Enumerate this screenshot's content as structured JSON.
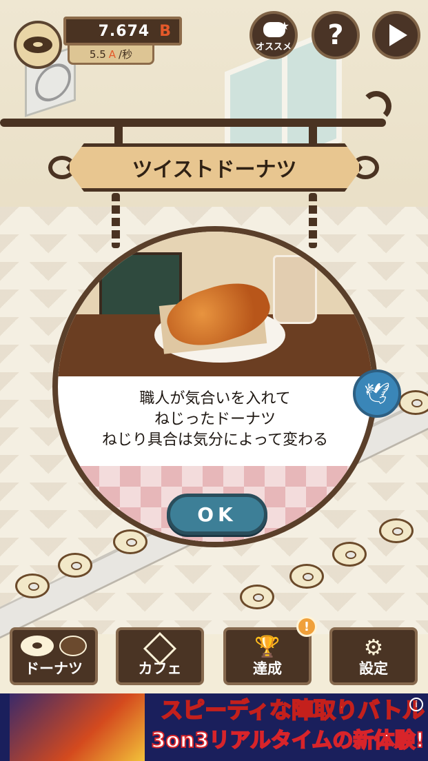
{
  "hud": {
    "money_value": "7.674",
    "money_unit": "B",
    "rate_value": "5.5",
    "rate_unit": "A",
    "rate_suffix": "/秒"
  },
  "top_buttons": {
    "recommend_label": "オススメ",
    "help_label": "?"
  },
  "sign": {
    "title": "ツイストドーナツ"
  },
  "popup": {
    "description": [
      "職人が気合いを入れて",
      "ねじったドーナツ",
      "ねじり具合は気分によって変わる"
    ],
    "ok_label": "OK",
    "share_icon": "twitter-bird-icon"
  },
  "nav": {
    "donuts_label": "ドーナツ",
    "cafe_label": "カフェ",
    "achievements_label": "達成",
    "settings_label": "設定",
    "achievement_badge": "!"
  },
  "ad": {
    "line1": "スピーディな陣取りバトル",
    "line2": "3on3リアルタイムの新体験!",
    "info_label": "i"
  },
  "colors": {
    "panel_brown": "#4a3424",
    "ok_button": "#3d7f97",
    "twitter_blue": "#3a86b8",
    "accent_orange": "#e4592a"
  }
}
